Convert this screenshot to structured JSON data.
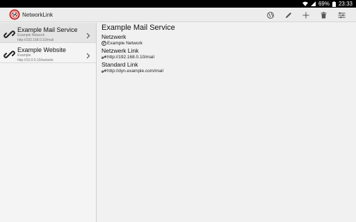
{
  "statusbar": {
    "battery": "69%",
    "time": "23:33"
  },
  "app": {
    "title": "NetworkLink"
  },
  "toolbar": {
    "actions": [
      {
        "icon": "globe-icon"
      },
      {
        "icon": "pencil-icon"
      },
      {
        "icon": "plus-icon"
      },
      {
        "icon": "trash-icon"
      },
      {
        "icon": "sliders-icon"
      }
    ]
  },
  "sidebar": {
    "items": [
      {
        "title": "Example Mail Service",
        "network": "Example Network",
        "url": "http://192.168.0.10/mail",
        "selected": true
      },
      {
        "title": "Example Website",
        "network": "Example",
        "url": "http://10.0.0.10/website",
        "selected": false
      }
    ]
  },
  "detail": {
    "title": "Example Mail Service",
    "network_label": "Netzwerk",
    "network_value": "Example Network",
    "network_link_label": "Netzwerk Link",
    "network_link_value": "http://192.168.0.10/mail",
    "standard_link_label": "Standard Link",
    "standard_link_value": "http://dyn.example.com/mail"
  },
  "colors": {
    "accent": "#c62828",
    "statusbar": "#000000",
    "actionbar": "#ececec"
  }
}
